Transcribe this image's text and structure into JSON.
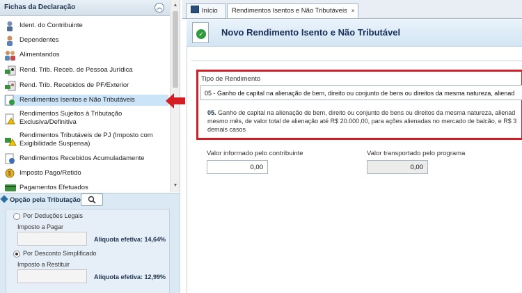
{
  "sidebar": {
    "title": "Fichas da Declaração",
    "items": [
      {
        "label": "Ident. do Contribuinte",
        "icon": "person-icon"
      },
      {
        "label": "Dependentes",
        "icon": "dependents-icon"
      },
      {
        "label": "Alimentandos",
        "icon": "family-icon"
      },
      {
        "label": "Rend. Trib. Receb. de Pessoa Jurídica",
        "icon": "money-pj-icon"
      },
      {
        "label": "Rend. Trib. Recebidos de PF/Exterior",
        "icon": "money-pf-icon"
      },
      {
        "label": "Rendimentos Isentos e Não Tributáveis",
        "icon": "doc-check-icon",
        "selected": true
      },
      {
        "label": "Rendimentos Sujeitos à Tributação",
        "label2": "Exclusiva/Definitiva",
        "icon": "warning-doc-icon"
      },
      {
        "label": "Rendimentos Tributáveis de PJ (Imposto com",
        "label2": "Exigibilidade Suspensa)",
        "icon": "money-warning-icon"
      },
      {
        "label": "Rendimentos Recebidos Acumuladamente",
        "icon": "doc-accum-icon"
      },
      {
        "label": "Imposto Pago/Retido",
        "icon": "coin-icon"
      },
      {
        "label": "Pagamentos Efetuados",
        "icon": "card-icon"
      }
    ]
  },
  "options": {
    "title": "Opção pela Tributação:",
    "deducoes_label": "Por Deduções Legais",
    "imposto_pagar_label": "Imposto a Pagar",
    "aliquota_1": "Alíquota efetiva: 14,64%",
    "simplificado_label": "Por Desconto Simplificado",
    "imposto_restituir_label": "Imposto a Restituir",
    "aliquota_2": "Alíquota efetiva: 12,99%"
  },
  "tabs": {
    "home_label": "Início",
    "active_label": "Rendimentos Isentos e Não Tributáveis",
    "close_glyph": "×"
  },
  "content": {
    "title": "Novo Rendimento Isento e Não Tributável",
    "tipo_label": "Tipo de Rendimento",
    "tipo_value": "05 - Ganho de capital na alienação de bem, direito ou conjunto de bens ou direitos da mesma natureza, alienad",
    "tipo_desc_code": "05.",
    "tipo_desc_text": " Ganho de capital na alienação de bem, direito ou conjunto de bens ou direitos da mesma natureza, alienad mesmo mês, de valor total de alienação até R$ 20.000,00, para ações alienadas no mercado de balcão, e R$ 3 demais casos",
    "valor_informado_label": "Valor informado pelo contribuinte",
    "valor_informado": "0,00",
    "valor_transportado_label": "Valor transportado pelo programa",
    "valor_transportado": "0,00"
  },
  "colors": {
    "highlight_red": "#d31e25",
    "selected_bg": "#cce4f7",
    "title_blue": "#17305a"
  }
}
